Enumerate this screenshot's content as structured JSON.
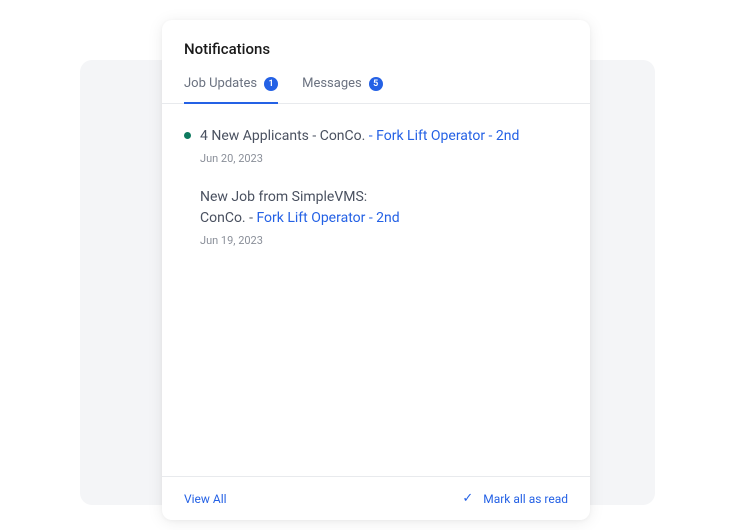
{
  "title": "Notifications",
  "tabs": [
    {
      "label": "Job Updates",
      "count": "1",
      "active": true
    },
    {
      "label": "Messages",
      "count": "5",
      "active": false
    }
  ],
  "items": [
    {
      "unread": true,
      "prefix": "4 New Applicants - ConCo.",
      "sep": " - ",
      "link": " Fork Lift Operator - 2nd",
      "line2_prefix": "",
      "line2_link": "",
      "date": "Jun 20, 2023"
    },
    {
      "unread": false,
      "prefix": "New Job from SimpleVMS:",
      "sep": "",
      "link": "",
      "line2_prefix": "ConCo. - ",
      "line2_link": " Fork Lift Operator - 2nd",
      "date": "Jun 19, 2023"
    }
  ],
  "footer": {
    "view_all": "View All",
    "mark_read": "Mark all as read"
  }
}
